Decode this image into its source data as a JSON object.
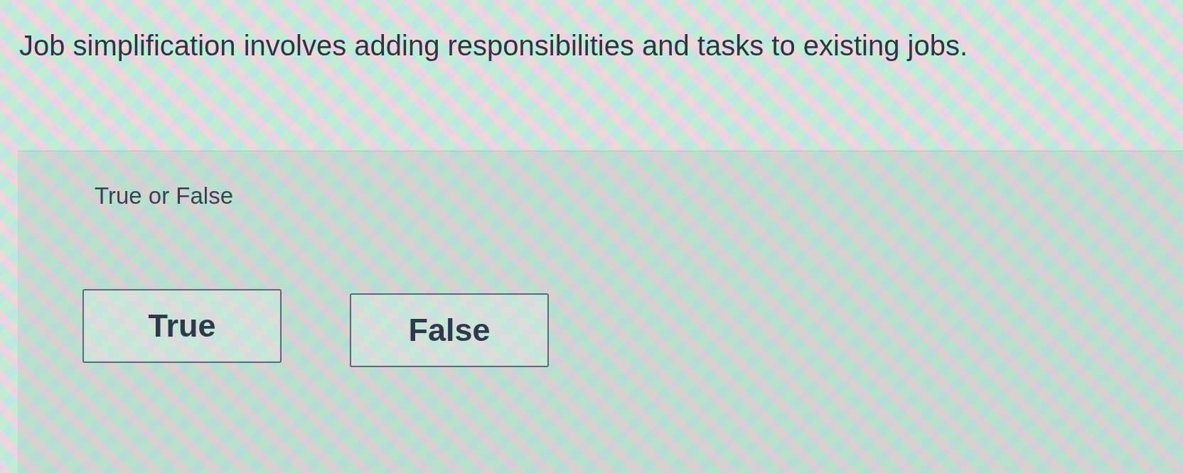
{
  "question": {
    "text": "Job simplification involves adding responsibilities and tasks to existing jobs."
  },
  "answer_panel": {
    "prompt": "True or False",
    "options": [
      {
        "label": "True",
        "selected": false
      },
      {
        "label": "False",
        "selected": false
      }
    ]
  }
}
